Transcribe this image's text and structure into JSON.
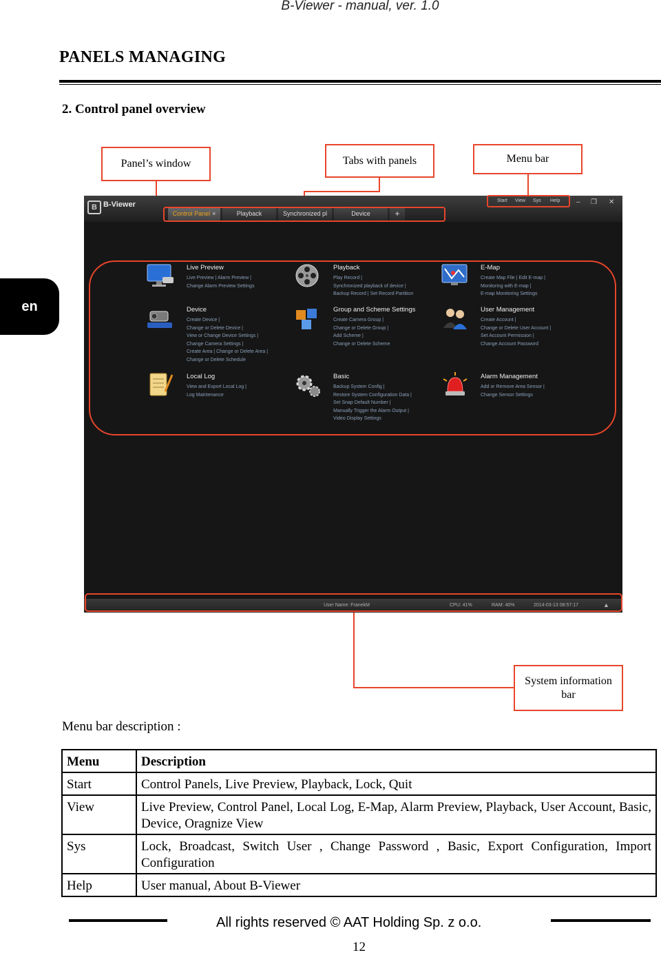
{
  "header": {
    "running_title": "B-Viewer - manual, ver. 1.0"
  },
  "section_title": "PANELS MANAGING",
  "subsection_title": "2. Control panel overview",
  "language_tab": "en",
  "callouts": {
    "panels_window": "Panel’s window",
    "tabs_with_panels": "Tabs with panels",
    "menu_bar": "Menu bar",
    "system_info_bar_line1": "System information",
    "system_info_bar_line2": "bar"
  },
  "screenshot": {
    "app_title": "B-Viewer",
    "tabs": [
      {
        "label": "Control Panel",
        "active": true
      },
      {
        "label": "Playback",
        "active": false
      },
      {
        "label": "Synchronized pl",
        "active": false
      },
      {
        "label": "Device",
        "active": false
      }
    ],
    "tab_close": "×",
    "add_tab": "+",
    "menu": [
      "Start",
      "View",
      "Sys",
      "Help"
    ],
    "window_controls": [
      "–",
      "❐",
      "✕"
    ],
    "panels": [
      {
        "title": "Live Preview",
        "links": [
          "Live Preview  |  Alarm Preview  |",
          "Change Alarm Preview Settings"
        ],
        "icon": "monitor-camera-icon"
      },
      {
        "title": "Playback",
        "links": [
          "Play Record  |",
          "Synchronized playback of device  |",
          "Backup Record  |  Set Record Partition"
        ],
        "icon": "film-reel-icon"
      },
      {
        "title": "E-Map",
        "links": [
          "Create Map File  |  Edit E-map  |",
          "Monitoring with E-map  |",
          "E-map Monitoring Settings"
        ],
        "icon": "map-icon"
      },
      {
        "title": "Device",
        "links": [
          "Create Device  |",
          "Change or Delete Device  |",
          "View or Change Device Settings  |",
          "Change Camera Settings  |",
          "Create Area  |  Change or Delete Area  |",
          "Change or Delete Schedule"
        ],
        "icon": "camera-device-icon"
      },
      {
        "title": "Group and Scheme Settings",
        "links": [
          "Create Camera Group  |",
          "Change or Delete Group  |",
          "Add Scheme  |",
          "Change or Delete Scheme"
        ],
        "icon": "cubes-icon"
      },
      {
        "title": "User Management",
        "links": [
          "Create Account  |",
          "Change or Delete User Account  |",
          "Set Account Permission  |",
          "Change Account Password"
        ],
        "icon": "users-icon"
      },
      {
        "title": "Local Log",
        "links": [
          "View and Export Local Log  |",
          "Log Maintenance"
        ],
        "icon": "notepad-icon"
      },
      {
        "title": "Basic",
        "links": [
          "Backup System Config  |",
          "Restore System Configuration Data  |",
          "Set Snap Default Number  |",
          "Manually Trigger the Alarm Output  |",
          "Video Display Settings"
        ],
        "icon": "gears-icon"
      },
      {
        "title": "Alarm Management",
        "links": [
          "Add or Remove Area Sensor  |",
          "Change Sensor Settings"
        ],
        "icon": "alarm-siren-icon"
      }
    ],
    "status": {
      "user": "User Name: FranekM",
      "cpu": "CPU: 41%",
      "ram": "RAM: 40%",
      "datetime": "2014-03-13 08:57:17",
      "arrow": "▲"
    }
  },
  "menu_desc_label": "Menu bar description :",
  "table": {
    "headers": [
      "Menu",
      "Description"
    ],
    "rows": [
      [
        "Start",
        "Control Panels, Live Preview, Playback, Lock, Quit"
      ],
      [
        "View",
        "Live Preview, Control Panel, Local Log, E-Map, Alarm Preview, Playback, User Account, Basic, Device, Oragnize View"
      ],
      [
        "Sys",
        "Lock, Broadcast, Switch User , Change Password , Basic, Export Configuration, Import Configuration"
      ],
      [
        "Help",
        "User manual, About B-Viewer"
      ]
    ]
  },
  "footer": {
    "copyright": "All rights reserved © AAT Holding  Sp. z o.o.",
    "page_number": "12"
  },
  "colors": {
    "callout_red": "#e8452a",
    "active_tab": "#f0a020",
    "screen_bg": "#161616"
  }
}
